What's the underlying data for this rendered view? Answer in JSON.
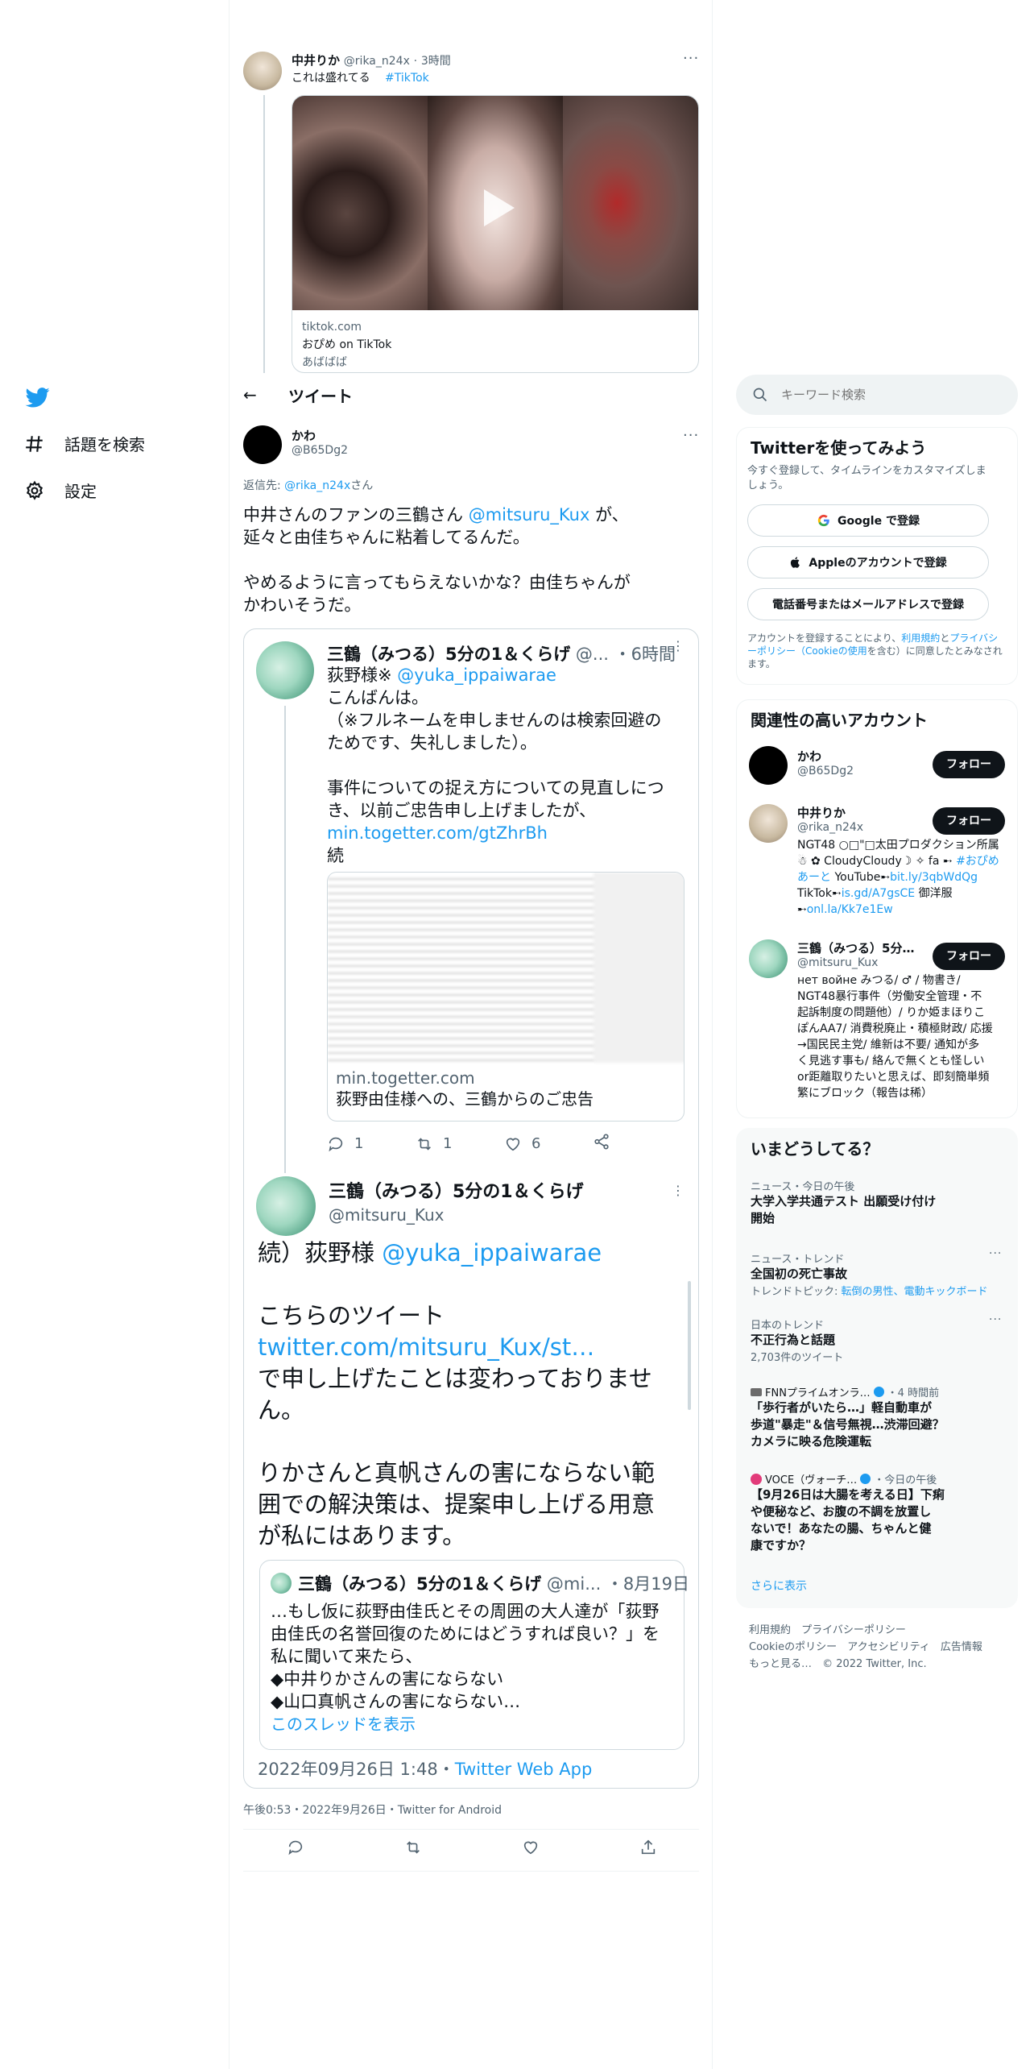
{
  "nav": {
    "explore_label": "話題を検索",
    "settings_label": "設定"
  },
  "preview_tweet": {
    "name": "中井りか",
    "handle": "@rika_n24x",
    "time": "3時間",
    "text": "これは盛れてる",
    "hashtag": "#TikTok",
    "link_domain": "tiktok.com",
    "link_title": "おぴめ on TikTok",
    "link_desc": "あばばば"
  },
  "header": {
    "title": "ツイート"
  },
  "search": {
    "placeholder": "キーワード検索"
  },
  "main_tweet": {
    "name": "かわ",
    "handle": "@B65Dg2",
    "reply_to_prefix": "返信先:",
    "reply_to_handle": "@rika_n24x",
    "reply_to_suffix": "さん",
    "line1_pre": "中井さんのファンの三鶴さん",
    "line1_mention": "@mitsuru_Kux",
    "line1_post": "が、",
    "line2": "延々と由佳ちゃんに粘着してるんだ。",
    "line3": "やめるように言ってもらえないかな？由佳ちゃんが",
    "line4": "かわいそうだ。",
    "timestamp": "午後0:53・2022年9月26日・Twitter for Android"
  },
  "embed": {
    "t1": {
      "name": "三鶴（みつる）5分の1＆くらげ",
      "handle": "@...",
      "time": "・6時間",
      "l1_pre": "荻野様※",
      "l1_mention": "@yuka_ippaiwarae",
      "l2": "こんばんは。",
      "l3": "（※フルネームを申しませんのは検索回避の",
      "l4": "ためです、失礼しました）。",
      "l5": "事件についての捉え方についての見直しにつ",
      "l6": "き、以前ご忠告申し上げましたが、",
      "l7_link": "min.togetter.com/gtZhrBh",
      "l8": "続",
      "card_domain": "min.togetter.com",
      "card_title": "荻野由佳様への、三鶴からのご忠告",
      "replies": "1",
      "retweets": "1",
      "likes": "6"
    },
    "t2": {
      "name": "三鶴（みつる）5分の1＆くらげ",
      "handle": "@mitsuru_Kux",
      "l1_pre": "続）荻野様",
      "l1_mention": "@yuka_ippaiwarae",
      "l2": "こちらのツイート",
      "l3_link": "twitter.com/mitsuru_Kux/st…",
      "l4": "で申し上げたことは変わっておりませ",
      "l5": "ん。",
      "l6": "りかさんと真帆さんの害にならない範",
      "l7": "囲での解決策は、提案申し上げる用意",
      "l8": "が私にはあります。",
      "quote_name": "三鶴（みつる）5分の1＆くらげ",
      "quote_handle": "@mi...",
      "quote_time": "・8月19日",
      "q1": "…もし仮に荻野由佳氏とその周囲の大人達が「荻野",
      "q2": "由佳氏の名誉回復のためにはどうすれば良い？」を",
      "q3": "私に聞いて来たら、",
      "q4": "◆中井りかさんの害にならない",
      "q5": "◆山口真帆さんの害にならない…",
      "show_thread": "このスレッドを表示",
      "date": "2022年09月26日 1:48・",
      "source": "Twitter Web App"
    }
  },
  "signup": {
    "title": "Twitterを使ってみよう",
    "desc1": "今すぐ登録して、タイムラインをカスタマイズしま",
    "desc2": "しょう。",
    "google": "Google で登録",
    "apple": "Appleのアカウントで登録",
    "phone": "電話番号またはメールアドレスで登録",
    "terms1": "アカウントを登録することにより、",
    "terms_link1": "利用規約",
    "terms2": "と",
    "terms_link2": "プライバシーポリシー（Cookieの使用",
    "terms3": "を含む）に同意したとみなされます。"
  },
  "related": {
    "title": "関連性の高いアカウント",
    "follow_label": "フォロー",
    "accounts": [
      {
        "name": "かわ",
        "handle": "@B65Dg2"
      },
      {
        "name": "中井りか",
        "handle": "@rika_n24x",
        "bio1": "NGT48 ○□\"□太田プロダクション所属",
        "bio2": "☃ ✿ CloudyCloudy☽ ✧ fa ➸",
        "bio2_link": "#おぴめ",
        "bio3_link": "あーと",
        "bio3": " YouTube➸",
        "bio3_link2": "bit.ly/3qbWdQg",
        "bio4": "TikTok➸",
        "bio4_link": "is.gd/A7gsCE",
        "bio4_post": " 御洋服",
        "bio5": "➸",
        "bio5_link": "onl.la/Kk7e1Ew"
      },
      {
        "name": "三鶴（みつる）5分…",
        "handle": "@mitsuru_Kux",
        "bio1": "нет войне みつる/ ♂ / 物書き/",
        "bio2": "NGT48暴行事件（労働安全管理・不",
        "bio3": "起訴制度の問題他）/ りか姫まほりこ",
        "bio4": "ぽんAA7/ 消費税廃止・積極財政/ 応援",
        "bio5": "→国民民主党/ 維新は不要/ 通知が多",
        "bio6": "く見逃す事も/ 絡んで無くとも怪しい",
        "bio7": "or距離取りたいと思えば、即刻簡単頻",
        "bio8": "繁にブロック（報告は稀）"
      }
    ]
  },
  "trends": {
    "title": "いまどうしてる？",
    "items": [
      {
        "meta": "ニュース・今日の午後",
        "title1": "大学入学共通テスト 出願受け付け",
        "title2": "開始"
      },
      {
        "meta": "ニュース・トレンド",
        "title1": "全国初の死亡事故",
        "sub_prefix": "トレンドトピック: ",
        "sub_links": "転倒の男性、電動キックボード"
      },
      {
        "meta": "日本のトレンド",
        "title1": "不正行為と話題",
        "count": "2,703件のツイート"
      },
      {
        "source": "FNNプライムオンラ…",
        "time": "・4 時間前",
        "title1": "「歩行者がいたら…」軽自動車が",
        "title2": "歩道\"暴走\"＆信号無視…渋滞回避？",
        "title3": "カメラに映る危険運転"
      },
      {
        "source": "VOCE（ヴォーチ…",
        "time": "・今日の午後",
        "title1": "【9月26日は大腸を考える日】下痢",
        "title2": "や便秘など、お腹の不調を放置し",
        "title3": "ないで！あなたの腸、ちゃんと健",
        "title4": "康ですか？"
      }
    ],
    "show_more": "さらに表示"
  },
  "footer": {
    "row1": [
      "利用規約",
      "プライバシーポリシー"
    ],
    "row2": [
      "Cookieのポリシー",
      "アクセシビリティ",
      "広告情報"
    ],
    "row3": [
      "もっと見る…",
      "© 2022 Twitter, Inc."
    ]
  },
  "colors": {
    "accent": "#1d9bf0",
    "text": "#0f1419",
    "muted": "#536471",
    "border": "#cfd9de"
  }
}
